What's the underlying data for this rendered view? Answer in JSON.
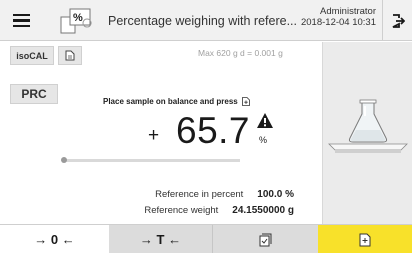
{
  "header": {
    "title": "Percentage weighing with refere...",
    "app_icon_label": "%",
    "user": "Administrator",
    "datetime": "2018-12-04  10:31"
  },
  "toolbar": {
    "isocal_label": "isoCAL",
    "capacity": "Max 620 g   d = 0.001 g",
    "prc_label": "PRC"
  },
  "weighing": {
    "instruction": "Place sample on balance and press",
    "sign": "+",
    "value": "65.7",
    "unit": "%",
    "progress": 0.0
  },
  "reference": {
    "percent_label": "Reference in percent",
    "percent_value": "100.0 %",
    "weight_label": "Reference weight",
    "weight_value": "24.1550000 g"
  },
  "bottom_bar": {
    "zero_label": "→ 0 ←",
    "tare_label": "→ T ←"
  },
  "colors": {
    "accent": "#f8e12a",
    "panel": "#ebebeb",
    "button": "#dcdcdc"
  }
}
